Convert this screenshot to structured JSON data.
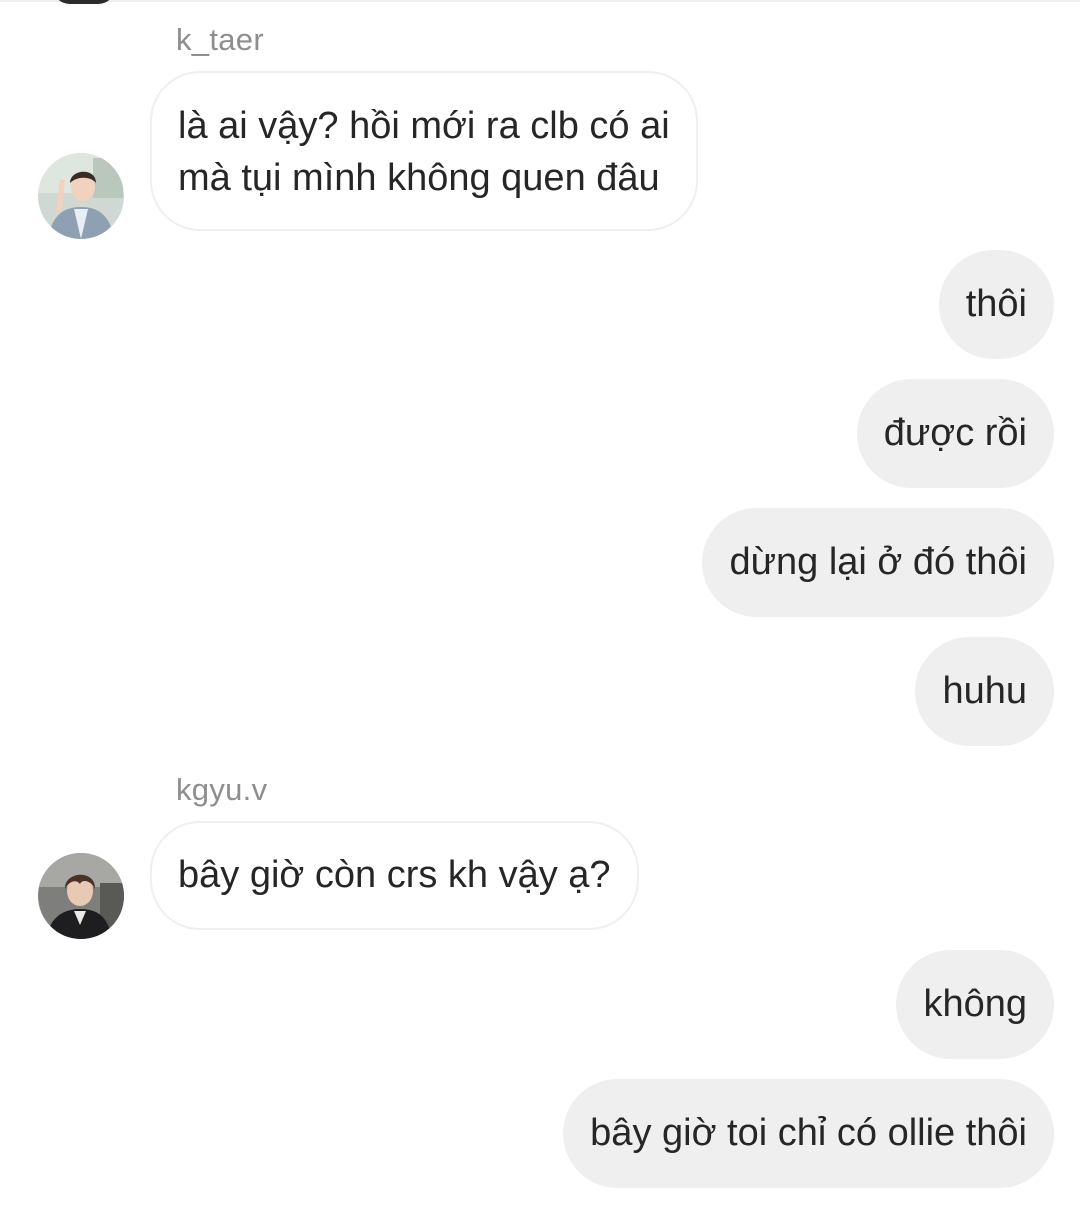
{
  "thread": {
    "messages": [
      {
        "direction": "incoming",
        "sender": "k_taer",
        "avatar_icon": "user-photo-icon",
        "lines": [
          "là ai vậy? hồi mới ra clb có ai",
          "mà tụi mình không quen đâu"
        ]
      },
      {
        "direction": "outgoing",
        "text": "thôi"
      },
      {
        "direction": "outgoing",
        "text": "được rồi"
      },
      {
        "direction": "outgoing",
        "text": "dừng lại ở đó thôi"
      },
      {
        "direction": "outgoing",
        "text": "huhu"
      },
      {
        "direction": "incoming",
        "sender": "kgyu.v",
        "avatar_icon": "user-photo-icon",
        "lines": [
          "bây giờ còn crs kh vậy ạ?"
        ]
      },
      {
        "direction": "outgoing",
        "text": "không"
      },
      {
        "direction": "outgoing",
        "text": "bây giờ toi chỉ có ollie thôi"
      }
    ]
  },
  "colors": {
    "background": "#ffffff",
    "outgoing_bubble": "#efefef",
    "incoming_border": "#efefef",
    "text": "#262626",
    "sender_text": "#8e8e8e"
  }
}
